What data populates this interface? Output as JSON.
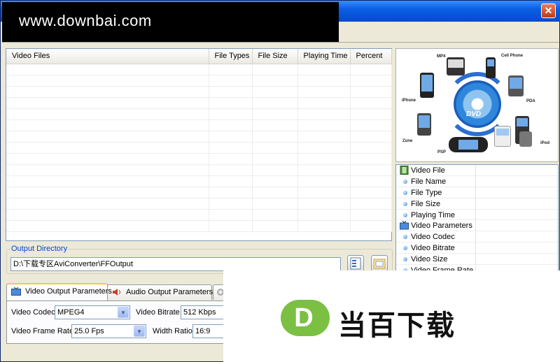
{
  "watermark_top": "www.downbai.com",
  "watermark_bottom": "当百下载",
  "watermark_logo_letter": "D",
  "window": {
    "close_label": "✕"
  },
  "filelist": {
    "columns": [
      "Video Files",
      "File Types",
      "File Size",
      "Playing Time",
      "Percent"
    ],
    "rows": []
  },
  "device_panel": {
    "labels": [
      "MP4",
      "Cell Phone",
      "iPhone",
      "PDA",
      "Zune",
      "PSP",
      "iPod",
      "DVD"
    ]
  },
  "properties": {
    "items": [
      {
        "label": "Video File",
        "kind": "category",
        "icon": "film-icon"
      },
      {
        "label": "File Name",
        "kind": "item"
      },
      {
        "label": "File Type",
        "kind": "item"
      },
      {
        "label": "File Size",
        "kind": "item"
      },
      {
        "label": "Playing Time",
        "kind": "item"
      },
      {
        "label": "Video Parameters",
        "kind": "category",
        "icon": "tv-icon"
      },
      {
        "label": "Video Codec",
        "kind": "item"
      },
      {
        "label": "Video Bitrate",
        "kind": "item"
      },
      {
        "label": "Video Size",
        "kind": "item"
      },
      {
        "label": "Video Frame Rate",
        "kind": "item"
      }
    ]
  },
  "output": {
    "label": "Output Directory",
    "path": "D:\\下载专区AviConverter\\FFOutput"
  },
  "tabs": [
    {
      "label": "Video Output Parameters",
      "active": true,
      "icon": "tv-icon"
    },
    {
      "label": "Audio Output Parameters",
      "active": false,
      "icon": "speaker-icon"
    },
    {
      "label": "",
      "active": false,
      "icon": "gear-icon"
    }
  ],
  "video_params": {
    "codec_label": "Video Codec",
    "codec_value": "MPEG4",
    "bitrate_label": "Video Bitrate",
    "bitrate_value": "512 Kbps",
    "framerate_label": "Video Frame Rate",
    "framerate_value": "25.0 Fps",
    "width_ratio_label": "Width Ratio",
    "width_ratio_value": "16:9"
  },
  "colors": {
    "titlebar": "#0550D8",
    "accent_label": "#0046D5",
    "logo_green": "#7BC043"
  }
}
